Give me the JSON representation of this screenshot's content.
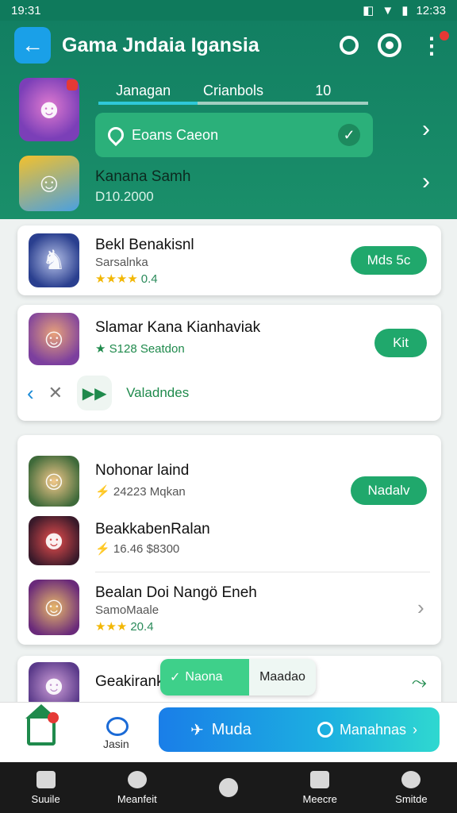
{
  "status_bar": {
    "left_time": "19:31",
    "right_time": "12:33",
    "icons": [
      "nfc-icon",
      "wifi-icon",
      "battery-icon"
    ]
  },
  "app_bar": {
    "title": "Gama Jndaia Igansia",
    "icons": [
      "back-arrow-icon",
      "search-icon",
      "record-icon",
      "more-vert-icon"
    ]
  },
  "tabs": [
    {
      "label": "Janagan",
      "active": true
    },
    {
      "label": "Crianbols",
      "active": false
    },
    {
      "label": "10",
      "active": false
    }
  ],
  "location": {
    "label": "Eoans Caeon",
    "icon": "location-pin-icon",
    "confirm_icon": "check-icon"
  },
  "featured": {
    "title": "Kanana Samh",
    "subtitle": "D10.2000"
  },
  "items": [
    {
      "title": "Bekl Benakisnl",
      "subtitle": "Sarsalnka",
      "rating_text": "0.4",
      "stars": 4,
      "button": "Mds 5c"
    },
    {
      "title": "Slamar Kana Kianhaviak",
      "subtitle": "S128 Seatdon",
      "button": "Kit",
      "controls_label": "Valadndes"
    },
    {
      "title": "Nohonar laind",
      "subtitle": "24223 Mqkan",
      "button": "Nadalv"
    },
    {
      "title": "BeakkabenRalan",
      "subtitle": "16.46 $8300"
    },
    {
      "title": "Bealan Doi Nangö Eneh",
      "subtitle": "SamoMaale",
      "rating_text": "20.4",
      "stars": 3
    },
    {
      "title": "Geakirank"
    }
  ],
  "toast": {
    "primary": "Naona",
    "secondary": "Maadao"
  },
  "action_bar": {
    "home_badge": true,
    "chat_label": "Jasin",
    "pill_left": "Muda",
    "pill_right": "Manahnas"
  },
  "bottom_nav": [
    {
      "label": "Suuile",
      "icon": "home-icon"
    },
    {
      "label": "Meanfeit",
      "icon": "settings-icon"
    },
    {
      "label": "",
      "icon": "circle-icon"
    },
    {
      "label": "Meecre",
      "icon": "box-icon"
    },
    {
      "label": "Smitde",
      "icon": "person-icon"
    }
  ],
  "colors": {
    "primary": "#1a8f6a",
    "accent": "#20a86c",
    "pill_gradient_start": "#1a7ee8",
    "pill_gradient_end": "#2fd8d0"
  }
}
